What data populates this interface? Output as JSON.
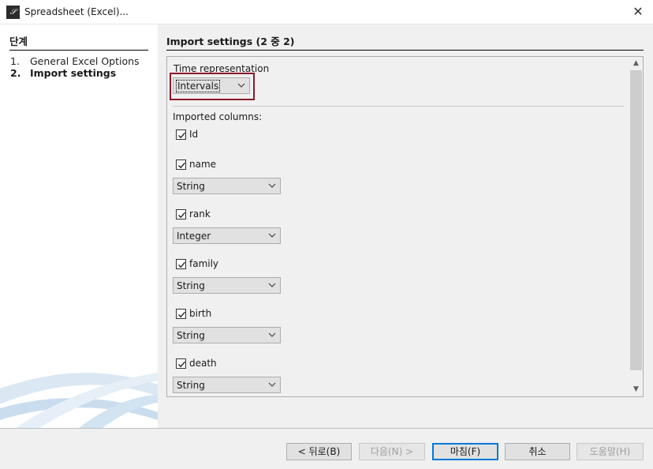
{
  "window": {
    "title": "Spreadsheet (Excel)...",
    "close_glyph": "✕"
  },
  "steps": {
    "heading": "단계",
    "items": [
      {
        "num": "1.",
        "label": "General Excel Options"
      },
      {
        "num": "2.",
        "label": "Import settings"
      }
    ]
  },
  "main": {
    "heading": "Import settings (2 중 2)",
    "time_representation": {
      "label": "Time representation",
      "value": "Intervals"
    },
    "imported_columns_label": "Imported columns:",
    "columns": [
      {
        "name": "Id",
        "checked": true
      },
      {
        "name": "name",
        "checked": true,
        "type": "String"
      },
      {
        "name": "rank",
        "checked": true,
        "type": "Integer"
      },
      {
        "name": "family",
        "checked": true,
        "type": "String"
      },
      {
        "name": "birth",
        "checked": true,
        "type": "String"
      },
      {
        "name": "death",
        "checked": true,
        "type": "String"
      }
    ]
  },
  "footer": {
    "back": "< 뒤로(B)",
    "next": "다음(N) >",
    "finish": "마침(F)",
    "cancel": "취소",
    "help": "도움말(H)"
  },
  "colors": {
    "highlight_border": "#8b1a2b",
    "default_button_border": "#0078d7"
  }
}
